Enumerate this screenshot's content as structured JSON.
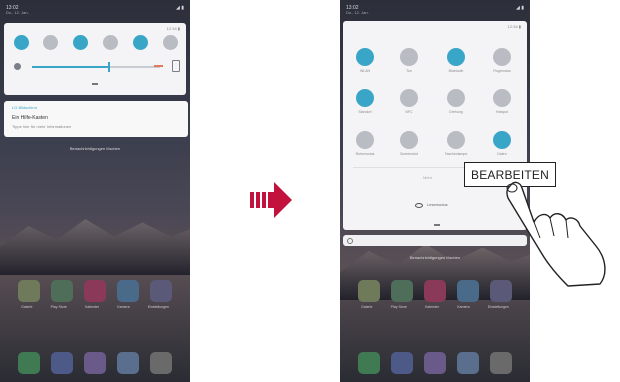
{
  "colors": {
    "accent": "#39a6c8",
    "tile_off": "#b9bcc2",
    "arrow": "#c4123f"
  },
  "left_screen": {
    "statusbar": {
      "time": "13:02",
      "date": "Do., 12. Jan.",
      "icons": "◢ ▮"
    },
    "quick_panel": {
      "top_info": "12:34 ▮",
      "tiles": [
        {
          "icon": "wifi-icon",
          "state": "on"
        },
        {
          "icon": "sound-icon",
          "state": "off"
        },
        {
          "icon": "bluetooth-icon",
          "state": "on"
        },
        {
          "icon": "rotation-icon",
          "state": "off"
        },
        {
          "icon": "location-icon",
          "state": "on"
        },
        {
          "icon": "more-icon",
          "state": "off"
        }
      ],
      "brightness_level": 0.6
    },
    "notification": {
      "app": "LG Bildschirm",
      "title": "Ein Hilfe-Kasten",
      "subtitle": "Tippe hier für mehr Informationen"
    },
    "clear_label": "Benachrichtigungen löschen",
    "home_apps": [
      "Galerie",
      "Play Store",
      "Kalender",
      "Kamera",
      "Einstellungen"
    ],
    "dock_apps": [
      "phone-icon",
      "messages-icon",
      "contacts-icon",
      "gallery-icon",
      "camera-icon"
    ]
  },
  "right_screen": {
    "statusbar": {
      "time": "13:02",
      "date": "Do., 12. Jan.",
      "icons": "◢ ▮"
    },
    "quick_panel": {
      "top_info": "12:34 ▮",
      "tiles": [
        {
          "label": "WLAN",
          "state": "on"
        },
        {
          "label": "Ton",
          "state": "off"
        },
        {
          "label": "Bluetooth",
          "state": "on"
        },
        {
          "label": "Flugmodus",
          "state": "off"
        },
        {
          "label": "Standort",
          "state": "on"
        },
        {
          "label": "NFC",
          "state": "off"
        },
        {
          "label": "Drehung",
          "state": "off"
        },
        {
          "label": "Hotspot",
          "state": "off"
        },
        {
          "label": "Ruhemodus",
          "state": "off"
        },
        {
          "label": "Screenshot",
          "state": "off"
        },
        {
          "label": "Taschenlampe",
          "state": "off"
        },
        {
          "label": "Daten",
          "state": "on"
        }
      ],
      "small_label": "Mehr",
      "eye_label": "Lesemodus",
      "edit_label": "BEARBEITEN"
    },
    "clear_label": "Benachrichtigungen löschen",
    "home_apps": [
      "Galerie",
      "Play Store",
      "Kalender",
      "Kamera",
      "Einstellungen"
    ],
    "dock_apps": [
      "phone-icon",
      "messages-icon",
      "contacts-icon",
      "gallery-icon",
      "camera-icon"
    ]
  }
}
